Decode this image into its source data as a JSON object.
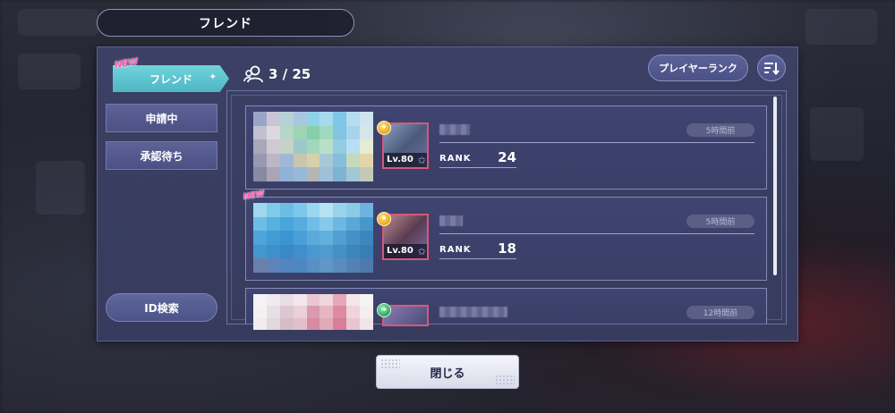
{
  "header": {
    "title": "フレンド"
  },
  "sidebar": {
    "new_badge": "NEW",
    "tabs": [
      {
        "label": "フレンド",
        "active": true
      },
      {
        "label": "申請中",
        "active": false
      },
      {
        "label": "承認待ち",
        "active": false
      }
    ],
    "id_search_label": "ID検索"
  },
  "friend_count": {
    "icon": "friends-icon",
    "text": "3 / 25",
    "current": 3,
    "max": 25
  },
  "toolbar": {
    "sort_label": "プレイヤーランク",
    "sort_icon": "sort-descending-icon"
  },
  "friends": [
    {
      "time": "5時間前",
      "rank_label": "RANK",
      "rank": "24",
      "level": "Lv.80",
      "attribute_icon": "star-attribute-icon",
      "is_new": false
    },
    {
      "time": "5時間前",
      "rank_label": "RANK",
      "rank": "18",
      "level": "Lv.80",
      "attribute_icon": "star-attribute-icon",
      "is_new": true
    },
    {
      "time": "12時間前",
      "attribute_icon": "leaf-attribute-icon",
      "is_new": false
    }
  ],
  "close_label": "閉じる",
  "colors": {
    "panel": "#3b4064",
    "active_tab": "#5fc6d0",
    "new_badge": "#ff5ab4",
    "avatar_border": "#d9577a"
  }
}
